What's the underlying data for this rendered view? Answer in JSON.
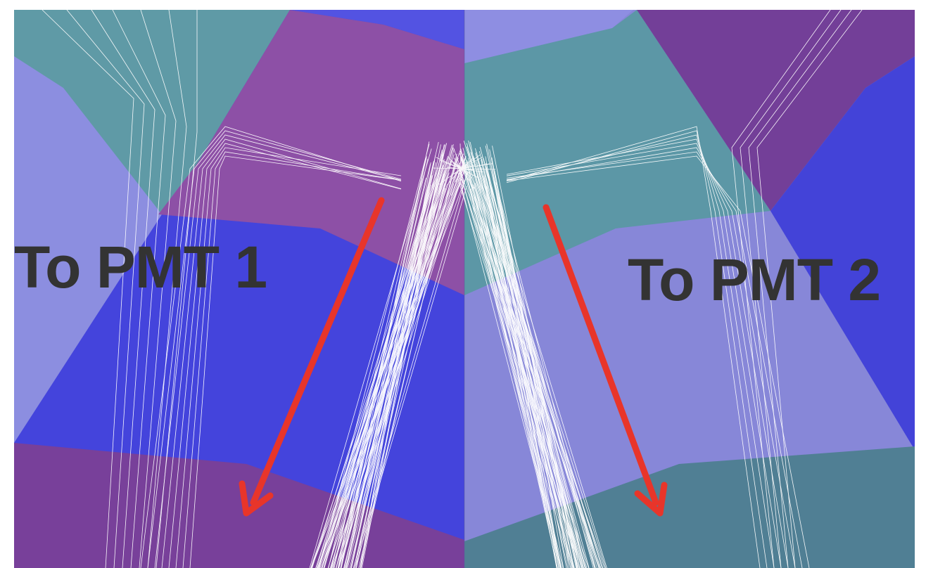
{
  "labels": {
    "left": "To PMT 1",
    "right": "To PMT 2"
  },
  "colors": {
    "teal": "#5e9aa6",
    "purple": "#8c50a6",
    "blue": "#4646de",
    "lavender": "#8c8ee0",
    "dark_purple": "#763f95",
    "arrow": "#e8352a",
    "tracks": "#ffffff",
    "label_text": "#333333"
  },
  "icons": [
    "arrow-down-left-icon",
    "arrow-down-right-icon"
  ]
}
